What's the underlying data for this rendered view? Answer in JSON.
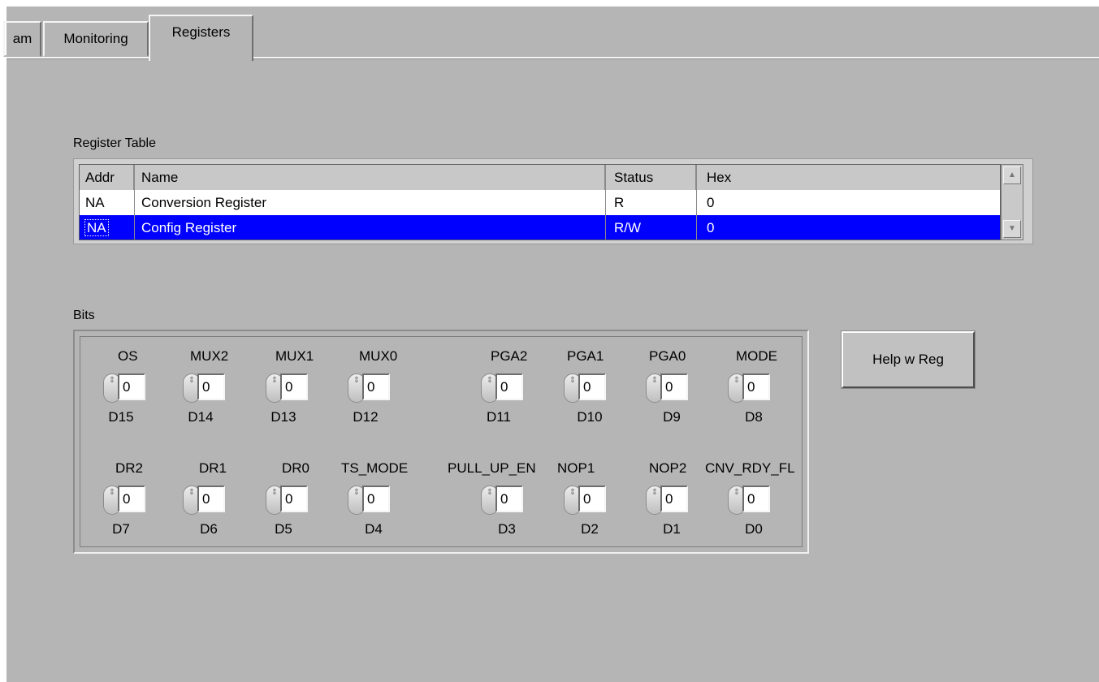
{
  "tabs": [
    {
      "label": "am",
      "active": false
    },
    {
      "label": "Monitoring",
      "active": false
    },
    {
      "label": "Registers",
      "active": true
    }
  ],
  "register_table": {
    "label": "Register Table",
    "columns": [
      "Addr",
      "Name",
      "Status",
      "Hex"
    ],
    "rows": [
      {
        "addr": "NA",
        "name": "Conversion Register",
        "status": "R",
        "hex": "0",
        "selected": false
      },
      {
        "addr": "NA",
        "name": "Config Register",
        "status": "R/W",
        "hex": "0",
        "selected": true
      }
    ]
  },
  "bits": {
    "label": "Bits",
    "row1": [
      {
        "name": "OS",
        "value": "0",
        "bit": "D15"
      },
      {
        "name": "MUX2",
        "value": "0",
        "bit": "D14"
      },
      {
        "name": "MUX1",
        "value": "0",
        "bit": "D13"
      },
      {
        "name": "MUX0",
        "value": "0",
        "bit": "D12"
      },
      {
        "name": "PGA2",
        "value": "0",
        "bit": "D11"
      },
      {
        "name": "PGA1",
        "value": "0",
        "bit": "D10"
      },
      {
        "name": "PGA0",
        "value": "0",
        "bit": "D9"
      },
      {
        "name": "MODE",
        "value": "0",
        "bit": "D8"
      }
    ],
    "row2": [
      {
        "name": "DR2",
        "value": "0",
        "bit": "D7"
      },
      {
        "name": "DR1",
        "value": "0",
        "bit": "D6"
      },
      {
        "name": "DR0",
        "value": "0",
        "bit": "D5"
      },
      {
        "name": "TS_MODE",
        "value": "0",
        "bit": "D4"
      },
      {
        "name": "PULL_UP_EN",
        "value": "0",
        "bit": "D3"
      },
      {
        "name": "NOP1",
        "value": "0",
        "bit": "D2"
      },
      {
        "name": "NOP2",
        "value": "0",
        "bit": "D1"
      },
      {
        "name": "CNV_RDY_FL",
        "value": "0",
        "bit": "D0"
      }
    ]
  },
  "help_button": {
    "label": "Help w Reg"
  },
  "colors": {
    "panel": "#b5b5b5",
    "selection": "#0000ff"
  }
}
